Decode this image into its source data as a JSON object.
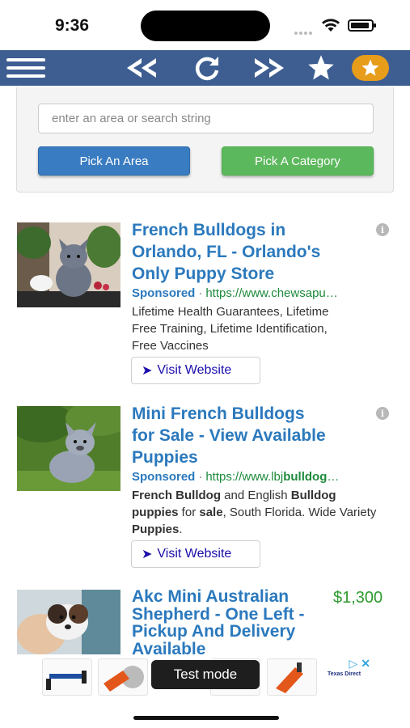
{
  "status_bar": {
    "time": "9:36"
  },
  "toolbar": {
    "icons": [
      "menu-icon",
      "rewind-icon",
      "refresh-icon",
      "fast-forward-icon",
      "star-icon",
      "favorites-star-icon"
    ],
    "color": "#3e5e92",
    "accent": "#e79d1a"
  },
  "search": {
    "placeholder": "enter an area or search string",
    "pick_area_label": "Pick An Area",
    "pick_category_label": "Pick A Category"
  },
  "listings": [
    {
      "title_lines": [
        "French Bulldogs in",
        "Orlando, FL - Orlando's",
        "Only Puppy Store"
      ],
      "sponsored": "Sponsored",
      "separator": "·",
      "url": "https://www.chewsapu…",
      "description_lines": [
        "Lifetime Health Guarantees, Lifetime",
        "Free Training, Lifetime Identification,",
        "Free Vaccines"
      ],
      "visit_label": "Visit Website"
    },
    {
      "title_lines": [
        "Mini French Bulldogs",
        "for Sale - View Available",
        "Puppies"
      ],
      "sponsored": "Sponsored",
      "separator": "·",
      "url_prefix": "https://www.lbj",
      "url_bold": "bulldog",
      "url_suffix": "…",
      "description_parts": [
        {
          "text": "French Bulldog",
          "bold": true
        },
        {
          "text": " and English ",
          "bold": false
        },
        {
          "text": "Bulldog",
          "bold": true
        },
        {
          "text": " ",
          "bold": false
        },
        {
          "text": "puppies",
          "bold": true
        },
        {
          "text": " for ",
          "bold": false
        },
        {
          "text": "sale",
          "bold": true
        },
        {
          "text": ", South Florida. Wide Variety ",
          "bold": false
        },
        {
          "text": "Puppies",
          "bold": true
        },
        {
          "text": ".",
          "bold": false
        }
      ],
      "visit_label": "Visit Website"
    },
    {
      "title_lines": [
        "Akc Mini Australian",
        "Shepherd - One Left -",
        "Pickup And Delivery",
        "Available"
      ],
      "price": "$1,300"
    }
  ],
  "ad_banner": {
    "test_mode_label": "Test mode",
    "logo_text": "Texas Direct"
  },
  "colors": {
    "title_blue": "#2b79bd",
    "url_green": "#1e8a3c",
    "price_green": "#2e9a2e",
    "pick_area_blue": "#3a7cc1",
    "pick_category_green": "#5cb85c"
  }
}
